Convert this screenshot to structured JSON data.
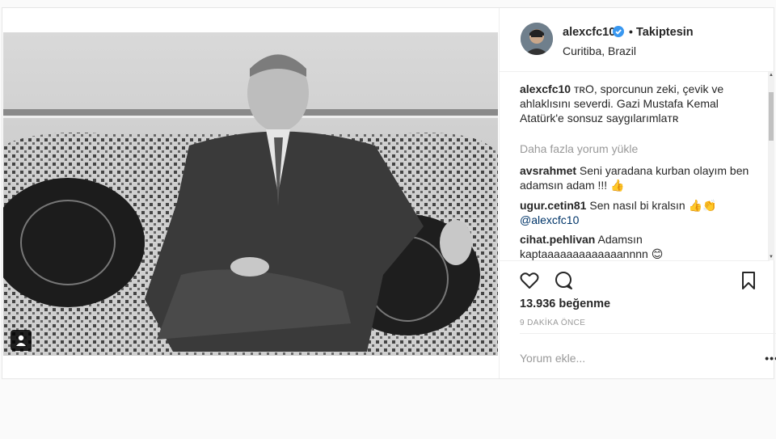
{
  "post": {
    "username": "alexcfc10",
    "follow_status": "Takiptesin",
    "separator": "•",
    "location": "Curitiba, Brazil",
    "caption_user": "alexcfc10",
    "caption_text": " ᴛʀO, sporcunun zeki, çevik ve ahlaklısını severdi. Gazi Mustafa Kemal Atatürk'e sonsuz saygılarımlaᴛʀ",
    "load_more": "Daha fazla yorum yükle",
    "comments": [
      {
        "user": "avsrahmet",
        "text": " Seni yaradana kurban olayım ben adamsın adam !!! 👍"
      },
      {
        "user": "ugur.cetin81",
        "text": " Sen nasıl bi kralsın 👍👏 ",
        "mention": "@alexcfc10"
      },
      {
        "user": "cihat.pehlivan",
        "text": " Adamsın kaptaaaaaaaaaaaaannnn 😊"
      }
    ],
    "likes": "13.936 beğenme",
    "time_ago": "9 DAKİKA ÖNCE",
    "comment_placeholder": "Yorum ekle...",
    "more_menu": "•••"
  },
  "icons": {
    "verified": "verified-badge-icon",
    "like": "heart-icon",
    "comment": "comment-bubble-icon",
    "save": "bookmark-icon",
    "tag": "user-tag-icon"
  },
  "colors": {
    "verified_blue": "#3897f0",
    "mention": "#003569",
    "muted": "#999999"
  }
}
